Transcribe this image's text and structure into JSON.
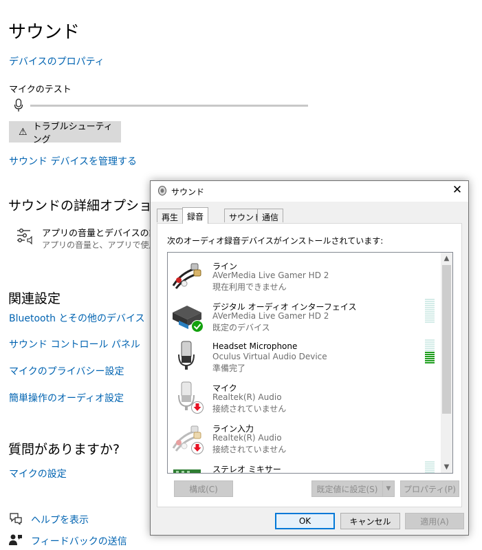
{
  "settings": {
    "title": "サウンド",
    "device_properties": "デバイスのプロパティ",
    "mic_test_label": "マイクのテスト",
    "troubleshoot_label": "トラブルシューティング",
    "manage_devices": "サウンド デバイスを管理する",
    "advanced_heading": "サウンドの詳細オプション",
    "app_volume_title": "アプリの音量とデバイスの設定",
    "app_volume_desc": "アプリの音量と、アプリで使用す",
    "related_heading": "関連設定",
    "related_links": [
      "Bluetooth とその他のデバイス",
      "サウンド コントロール パネル",
      "マイクのプライバシー設定",
      "簡単操作のオーディオ設定"
    ],
    "question_heading": "質問がありますか?",
    "mic_settings": "マイクの設定",
    "help_label": "ヘルプを表示",
    "feedback_label": "フィードバックの送信"
  },
  "dialog": {
    "title": "サウンド",
    "tabs": [
      "再生",
      "録音",
      "サウンド",
      "通信"
    ],
    "active_tab": "録音",
    "instruction": "次のオーディオ録音デバイスがインストールされています:",
    "devices": [
      {
        "name": "ライン",
        "driver": "AVerMedia Live Gamer HD 2",
        "status": "現在利用できません",
        "icon": "line-in-cable-icon",
        "meter_level": 0
      },
      {
        "name": "デジタル オーディオ インターフェイス",
        "driver": "AVerMedia Live Gamer HD 2",
        "status": "既定のデバイス",
        "icon": "digital-interface-icon",
        "meter_level": 0
      },
      {
        "name": "Headset Microphone",
        "driver": "Oculus Virtual Audio Device",
        "status": "準備完了",
        "icon": "headset-microphone-icon",
        "meter_level": 0.5
      },
      {
        "name": "マイク",
        "driver": "Realtek(R) Audio",
        "status": "接続されていません",
        "icon": "microphone-icon",
        "meter_level": 0
      },
      {
        "name": "ライン入力",
        "driver": "Realtek(R) Audio",
        "status": "接続されていません",
        "icon": "line-in-cable-icon",
        "meter_level": 0
      },
      {
        "name": "ステレオ ミキサー",
        "driver": "",
        "status": "",
        "icon": "stereo-mixer-icon",
        "meter_level": 0
      }
    ],
    "buttons": {
      "configure": "構成(C)",
      "set_default": "既定値に設定(S)",
      "properties": "プロパティ(P)",
      "ok": "OK",
      "cancel": "キャンセル",
      "apply": "適用(A)"
    },
    "colors": {
      "meter_active": "#1e9e1e",
      "meter_idle": "#d4ece8",
      "default_check": "#13a10e",
      "disconnected_arrow": "#e81123"
    }
  }
}
